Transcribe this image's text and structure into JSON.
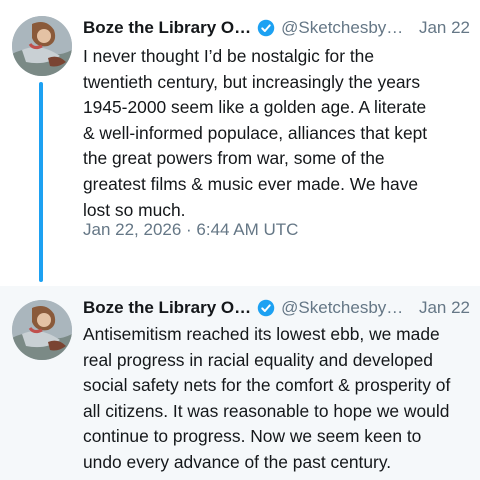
{
  "tweets": [
    {
      "author": {
        "display_name": "Boze the Library O…",
        "handle": "@Sketchesby…",
        "verified": true
      },
      "date": "Jan 22",
      "text": "I never thought I’d be nostalgic for the\ntwentieth century, but increasingly the years\n1945-2000 seem like a golden age. A literate\n& well-informed populace, alliances that kept\nthe great powers from war, some of the\ngreatest films & music ever made. We have\nlost so much.",
      "timestamp": "Jan 22, 2026 · 6:44 AM UTC"
    },
    {
      "author": {
        "display_name": "Boze the Library O…",
        "handle": "@Sketchesby…",
        "verified": true
      },
      "date": "Jan 22",
      "text": "Antisemitism reached its lowest ebb, we made\nreal progress in racial equality and developed\nsocial safety nets for the comfort & prosperity of\nall citizens. It was reasonable to hope we would\ncontinue to progress. Now we seem keen to\nundo every advance of the past century."
    }
  ],
  "colors": {
    "accent": "#1da1f2",
    "text": "#14171a",
    "muted": "#657786",
    "reply_background": "#f5f8fa"
  }
}
